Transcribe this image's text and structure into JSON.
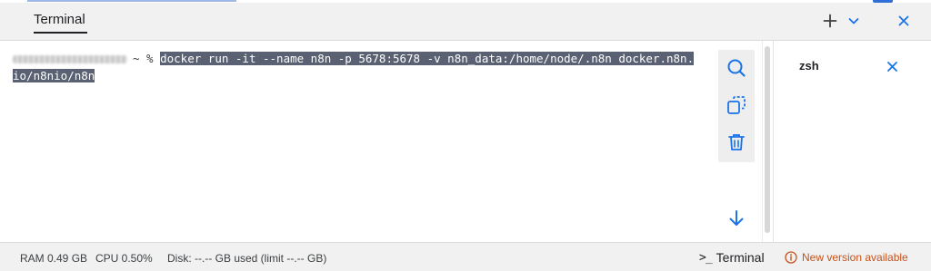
{
  "header": {
    "active_tab": "Terminal",
    "icons": [
      "plus-icon",
      "chevron-down-icon",
      "close-icon"
    ]
  },
  "terminal": {
    "prompt_suffix": "~ %",
    "command_line_1": "docker run -it --name n8n -p 5678:5678 -v n8n_data:/home/node/.n8n docker.n8n.",
    "command_line_2": "io/n8nio/n8n"
  },
  "toolbar": {
    "icons": [
      "search-icon",
      "copy-icon",
      "trash-icon",
      "arrow-down-icon"
    ]
  },
  "sidebar": {
    "sessions": [
      {
        "label": "zsh"
      }
    ]
  },
  "status": {
    "ram": "RAM 0.49 GB",
    "cpu": "CPU 0.50%",
    "disk": "Disk: --.-- GB used (limit --.-- GB)",
    "terminal_prompt": ">_",
    "terminal_label": "Terminal",
    "update_label": "New version available"
  },
  "colors": {
    "accent": "#1a73e8",
    "selection": "#5a6172",
    "warning": "#c5521a"
  }
}
